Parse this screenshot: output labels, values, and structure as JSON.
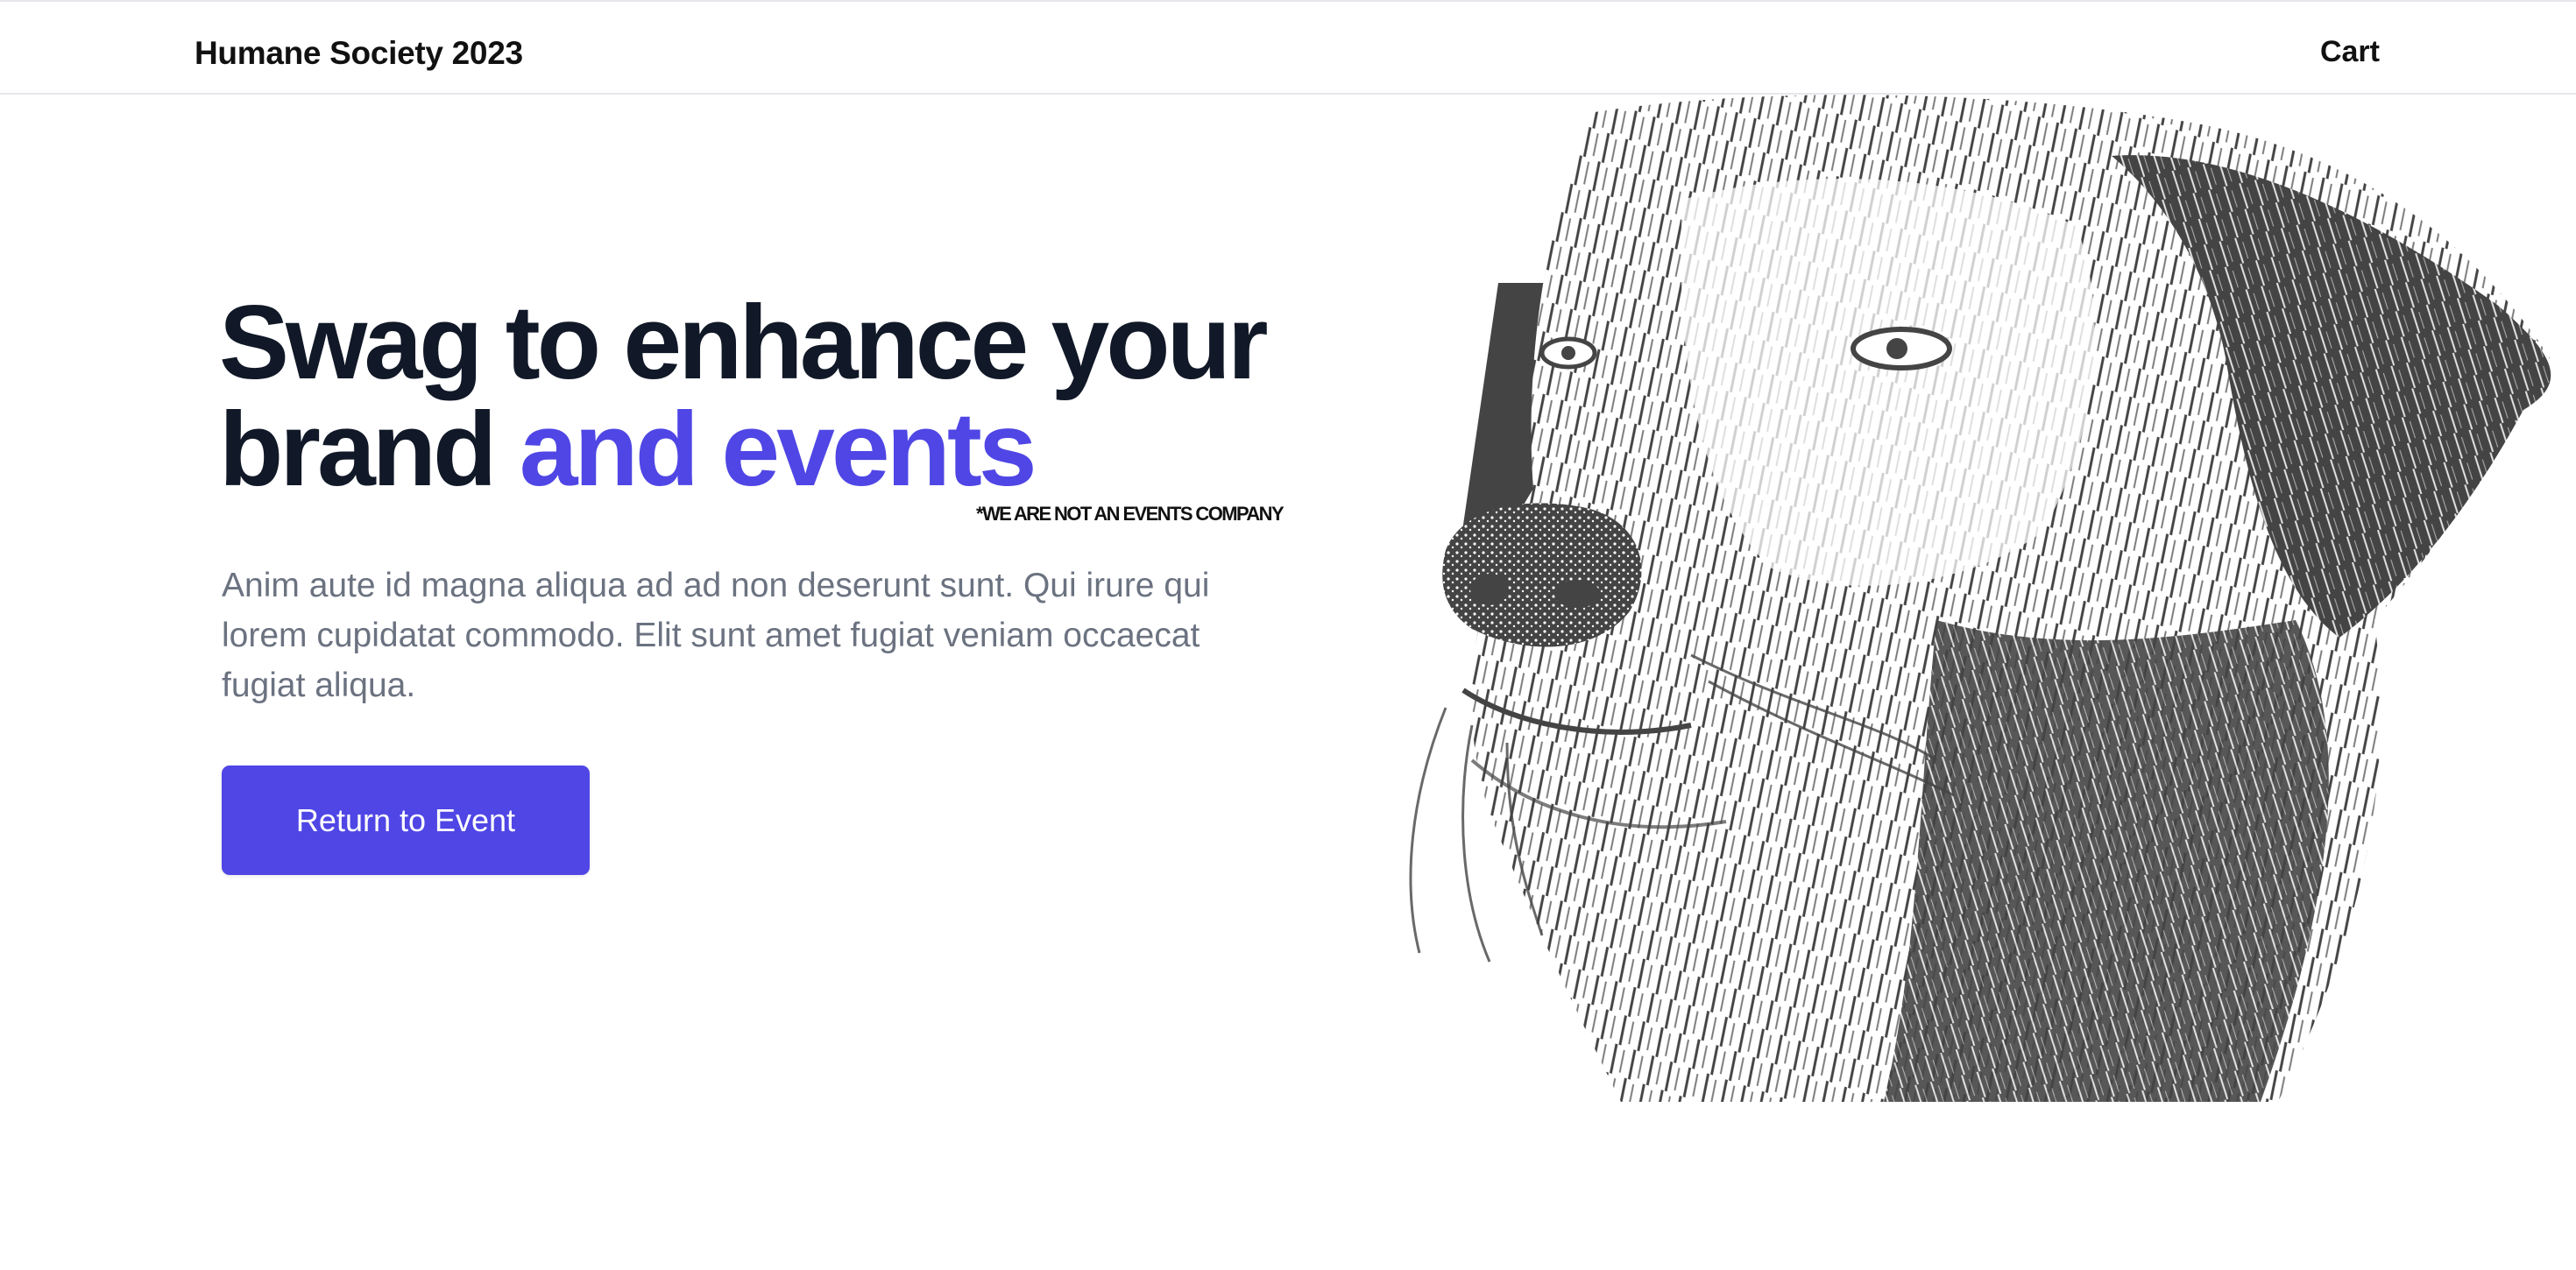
{
  "header": {
    "brand": "Humane Society 2023",
    "cart_label": "Cart"
  },
  "hero": {
    "title_part1": "Swag to enhance your brand ",
    "title_accent": "and events",
    "disclaimer": "*WE ARE NOT AN EVENTS COMPANY",
    "description": "Anim aute id magna aliqua ad ad non deserunt sunt. Qui irure qui lorem cupidatat commodo. Elit sunt amet fugiat veniam occaecat fugiat aliqua.",
    "cta_label": "Return to Event"
  },
  "colors": {
    "accent": "#4f46e5",
    "heading": "#111827",
    "body_text": "#6b7280",
    "illustration": "#444444"
  },
  "illustration": {
    "subject": "dog-portrait-illustration"
  }
}
